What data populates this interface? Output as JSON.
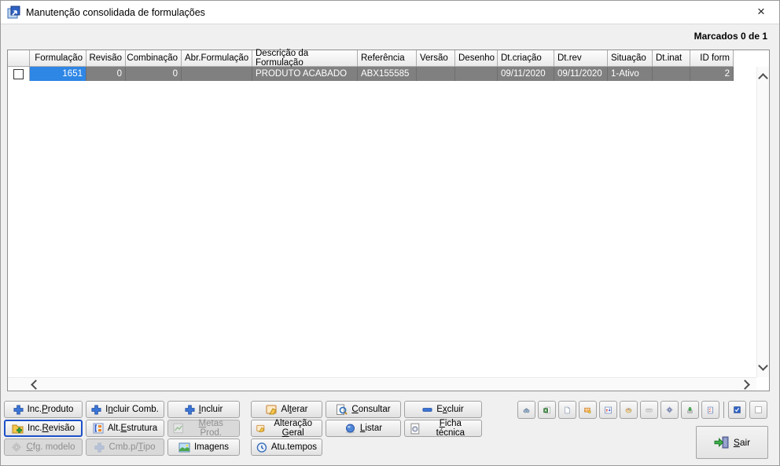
{
  "window": {
    "title": "Manutenção consolidada de formulações",
    "close_glyph": "×"
  },
  "status": {
    "marked": "Marcados 0 de 1"
  },
  "grid": {
    "headers": {
      "selector": "",
      "formulacao": "Formulação",
      "revisao": "Revisão",
      "combinacao": "Combinação",
      "abr_formulacao": "Abr.Formulação",
      "descricao": "Descrição da Formulação",
      "referencia": "Referência",
      "versao": "Versão",
      "desenho": "Desenho",
      "dt_criacao": "Dt.criação",
      "dt_rev": "Dt.rev",
      "situacao": "Situação",
      "dt_inat": "Dt.inat",
      "id_form": "ID form"
    },
    "row": {
      "selected": true,
      "checked": false,
      "formulacao": "1651",
      "revisao": "0",
      "combinacao": "0",
      "abr_formulacao": "",
      "descricao": "PRODUTO ACABADO",
      "referencia": "ABX155585",
      "versao": "",
      "desenho": "",
      "dt_criacao": "09/11/2020",
      "dt_rev": "09/11/2020",
      "situacao": "1-Ativo",
      "dt_inat": "",
      "id_form": "2"
    },
    "colors": {
      "selected_row_bg": "#808080",
      "focused_cell_bg": "#2E86E5",
      "selected_text": "#FFFFFF"
    }
  },
  "buttons": {
    "inc_produto": {
      "pre": "Inc.",
      "key": "P",
      "post": "roduto",
      "disabled": false
    },
    "incluir_comb": {
      "pre": "I",
      "key": "n",
      "post": "cluir Comb.",
      "disabled": false
    },
    "incluir": {
      "pre": "",
      "key": "I",
      "post": "ncluir",
      "disabled": false
    },
    "alterar": {
      "pre": "Al",
      "key": "t",
      "post": "erar",
      "disabled": false
    },
    "consultar": {
      "pre": "",
      "key": "C",
      "post": "onsultar",
      "disabled": false
    },
    "excluir": {
      "pre": "E",
      "key": "x",
      "post": "cluir",
      "disabled": false
    },
    "inc_revisao": {
      "pre": "Inc.",
      "key": "R",
      "post": "evisão",
      "disabled": false,
      "focused": true
    },
    "alt_estrutura": {
      "pre": "Alt.",
      "key": "E",
      "post": "strutura",
      "disabled": false
    },
    "metas_prod": {
      "pre": "",
      "key": "M",
      "post": "etas Prod.",
      "disabled": true
    },
    "alteracao_geral": {
      "pre": "Alteração ",
      "key": "G",
      "post": "eral",
      "disabled": false
    },
    "listar": {
      "pre": "",
      "key": "L",
      "post": "istar",
      "disabled": false
    },
    "ficha_tecnica": {
      "pre": "",
      "key": "F",
      "post": "icha técnica",
      "disabled": false
    },
    "cfg_modelo": {
      "pre": "",
      "key": "C",
      "post": "fg. modelo",
      "disabled": true
    },
    "cmb_p_tipo": {
      "pre": "Cmb.p/",
      "key": "T",
      "post": "ipo",
      "disabled": true
    },
    "imagens": {
      "pre": "",
      "key": "",
      "post": "Imagens",
      "disabled": false
    },
    "atu_tempos": {
      "pre": "",
      "key": "",
      "post": "Atu.tempos",
      "disabled": false
    },
    "sair": {
      "pre": "",
      "key": "S",
      "post": "air",
      "disabled": false
    }
  },
  "icon_buttons": [
    "binoculars-icon",
    "excel-export-icon",
    "new-document-icon",
    "send-table-icon",
    "sort-updown-icon",
    "palette-icon",
    "keyboard-icon",
    "gear-icon",
    "export-download-icon",
    "checklist-icon",
    "check-all-button",
    "uncheck-all-button"
  ]
}
